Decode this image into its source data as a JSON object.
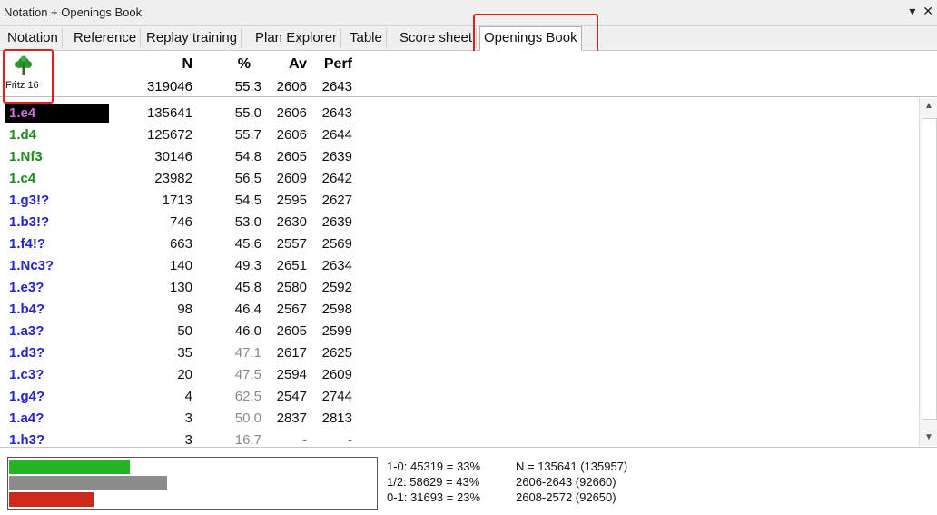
{
  "window": {
    "title": "Notation + Openings Book",
    "controls": [
      "▾",
      "✕"
    ]
  },
  "tabs": [
    {
      "label": "Notation"
    },
    {
      "label": "Reference"
    },
    {
      "label": "Replay training"
    },
    {
      "label": "Plan Explorer"
    },
    {
      "label": "Table"
    },
    {
      "label": "Score sheet"
    },
    {
      "label": "Openings Book",
      "active": true
    }
  ],
  "book": {
    "engine": "Fritz 16",
    "columns": {
      "n": "N",
      "pct": "%",
      "av": "Av",
      "perf": "Perf"
    },
    "totals": {
      "n": "319046",
      "pct": "55.3",
      "av": "2606",
      "perf": "2643"
    }
  },
  "moves": [
    {
      "move": "1.e4",
      "n": "135641",
      "pct": "55.0",
      "av": "2606",
      "perf": "2643",
      "color": "#d070e0",
      "selected": true,
      "pct_gray": false
    },
    {
      "move": "1.d4",
      "n": "125672",
      "pct": "55.7",
      "av": "2606",
      "perf": "2644",
      "color": "#1a8a1a",
      "selected": false,
      "pct_gray": false
    },
    {
      "move": "1.Nf3",
      "n": "30146",
      "pct": "54.8",
      "av": "2605",
      "perf": "2639",
      "color": "#1a8a1a",
      "selected": false,
      "pct_gray": false
    },
    {
      "move": "1.c4",
      "n": "23982",
      "pct": "56.5",
      "av": "2609",
      "perf": "2642",
      "color": "#1a8a1a",
      "selected": false,
      "pct_gray": false
    },
    {
      "move": "1.g3!?",
      "n": "1713",
      "pct": "54.5",
      "av": "2595",
      "perf": "2627",
      "color": "#2323d0",
      "selected": false,
      "pct_gray": false
    },
    {
      "move": "1.b3!?",
      "n": "746",
      "pct": "53.0",
      "av": "2630",
      "perf": "2639",
      "color": "#2323d0",
      "selected": false,
      "pct_gray": false
    },
    {
      "move": "1.f4!?",
      "n": "663",
      "pct": "45.6",
      "av": "2557",
      "perf": "2569",
      "color": "#2323d0",
      "selected": false,
      "pct_gray": false
    },
    {
      "move": "1.Nc3?",
      "n": "140",
      "pct": "49.3",
      "av": "2651",
      "perf": "2634",
      "color": "#2323d0",
      "selected": false,
      "pct_gray": false
    },
    {
      "move": "1.e3?",
      "n": "130",
      "pct": "45.8",
      "av": "2580",
      "perf": "2592",
      "color": "#2323d0",
      "selected": false,
      "pct_gray": false
    },
    {
      "move": "1.b4?",
      "n": "98",
      "pct": "46.4",
      "av": "2567",
      "perf": "2598",
      "color": "#2323d0",
      "selected": false,
      "pct_gray": false
    },
    {
      "move": "1.a3?",
      "n": "50",
      "pct": "46.0",
      "av": "2605",
      "perf": "2599",
      "color": "#2323d0",
      "selected": false,
      "pct_gray": false
    },
    {
      "move": "1.d3?",
      "n": "35",
      "pct": "47.1",
      "av": "2617",
      "perf": "2625",
      "color": "#2323d0",
      "selected": false,
      "pct_gray": true
    },
    {
      "move": "1.c3?",
      "n": "20",
      "pct": "47.5",
      "av": "2594",
      "perf": "2609",
      "color": "#2323d0",
      "selected": false,
      "pct_gray": true
    },
    {
      "move": "1.g4?",
      "n": "4",
      "pct": "62.5",
      "av": "2547",
      "perf": "2744",
      "color": "#2323d0",
      "selected": false,
      "pct_gray": true
    },
    {
      "move": "1.a4?",
      "n": "3",
      "pct": "50.0",
      "av": "2837",
      "perf": "2813",
      "color": "#2323d0",
      "selected": false,
      "pct_gray": true
    },
    {
      "move": "1.h3?",
      "n": "3",
      "pct": "16.7",
      "av": "-",
      "perf": "-",
      "color": "#2323d0",
      "selected": false,
      "pct_gray": true
    }
  ],
  "results": {
    "bars": [
      {
        "name": "white-wins-bar",
        "fraction": 0.33,
        "color": "#22b422"
      },
      {
        "name": "draws-bar",
        "fraction": 0.43,
        "color": "#8c8c8c"
      },
      {
        "name": "black-wins-bar",
        "fraction": 0.23,
        "color": "#cc2a1a"
      }
    ],
    "lines": [
      "1-0: 45319 = 33%",
      "1/2: 58629 = 43%",
      "0-1: 31693 = 23%"
    ],
    "info": [
      "N = 135641 (135957)",
      "2606-2643 (92660)",
      "2608-2572 (92650)"
    ]
  }
}
